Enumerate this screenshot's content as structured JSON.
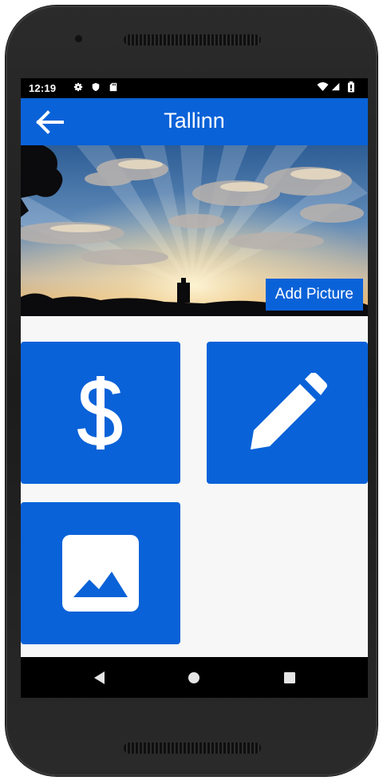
{
  "status_bar": {
    "time": "12:19",
    "icons_left": [
      "gear-icon",
      "shield-icon",
      "sd-card-icon"
    ],
    "icons_right": [
      "wifi-icon",
      "cell-signal-icon",
      "battery-icon"
    ]
  },
  "app_bar": {
    "title": "Tallinn",
    "back_icon": "arrow-left-icon",
    "color": "#0a62d8"
  },
  "hero": {
    "add_picture_label": "Add Picture"
  },
  "tiles": [
    {
      "name": "money",
      "icon": "dollar-icon"
    },
    {
      "name": "edit",
      "icon": "pencil-icon"
    },
    {
      "name": "gallery",
      "icon": "image-icon"
    }
  ],
  "nav_bar": {
    "buttons": [
      "back-triangle-icon",
      "home-circle-icon",
      "recents-square-icon"
    ]
  }
}
